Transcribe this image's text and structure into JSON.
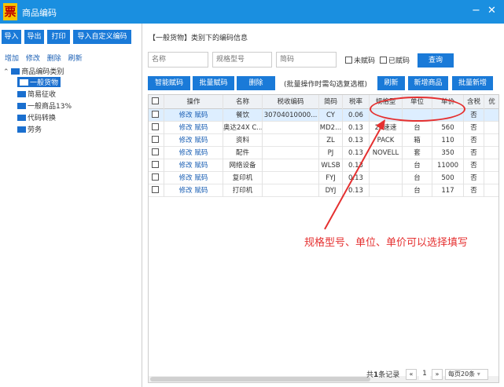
{
  "window": {
    "title": "商品编码",
    "logo_char": "票",
    "minimize": "−",
    "close": "✕"
  },
  "toolbar": {
    "import": "导入",
    "export": "导出",
    "print": "打印",
    "import_custom": "导入自定义编码"
  },
  "links": {
    "add": "增加",
    "edit": "修改",
    "delete": "删除",
    "refresh": "刷新"
  },
  "tree": {
    "root": "商品编码类别",
    "children": [
      "一般货物",
      "简易征收",
      "一般商品13%",
      "代码转换",
      "劳务"
    ]
  },
  "panel": {
    "title": "【一般货物】类别下的编码信息",
    "name_placeholder": "名称",
    "spec_placeholder": "规格型号",
    "short_placeholder": "简码",
    "unassigned": "未赋码",
    "assigned": "已赋码",
    "query": "查询"
  },
  "actions": {
    "smart_assign": "智能赋码",
    "batch_assign": "批量赋码",
    "delete": "删除",
    "hint": "(批量操作时需勾选复选框)",
    "refresh": "刷新",
    "add_goods": "新增商品",
    "batch_add": "批量新增"
  },
  "table": {
    "columns": [
      "操作",
      "名称",
      "税收编码",
      "简码",
      "税率",
      "规格型",
      "单位",
      "单价",
      "含税",
      "优"
    ],
    "op_edit": "修改",
    "op_assign": "赋码",
    "rows": [
      {
        "name": "餐饮",
        "tax_code": "30704010000...",
        "short": "CY",
        "rate": "0.06",
        "spec": "",
        "unit": "",
        "price": "",
        "tax_incl": "否"
      },
      {
        "name": "奥达24X C...",
        "tax_code": "",
        "short": "MD2...",
        "rate": "0.13",
        "spec": "24速速",
        "unit": "台",
        "price": "560",
        "tax_incl": "否"
      },
      {
        "name": "资料",
        "tax_code": "",
        "short": "ZL",
        "rate": "0.13",
        "spec": "PACK",
        "unit": "箱",
        "price": "110",
        "tax_incl": "否"
      },
      {
        "name": "配件",
        "tax_code": "",
        "short": "PJ",
        "rate": "0.13",
        "spec": "NOVELL",
        "unit": "套",
        "price": "350",
        "tax_incl": "否"
      },
      {
        "name": "网络设备",
        "tax_code": "",
        "short": "WLSB",
        "rate": "0.13",
        "spec": "",
        "unit": "台",
        "price": "11000",
        "tax_incl": "否"
      },
      {
        "name": "复印机",
        "tax_code": "",
        "short": "FYJ",
        "rate": "0.13",
        "spec": "",
        "unit": "台",
        "price": "500",
        "tax_incl": "否"
      },
      {
        "name": "打印机",
        "tax_code": "",
        "short": "DYJ",
        "rate": "0.13",
        "spec": "",
        "unit": "台",
        "price": "117",
        "tax_incl": "否"
      }
    ]
  },
  "pager": {
    "total_prefix": "共",
    "total_count": "1",
    "total_suffix": "条记录",
    "prev": "«",
    "page": "1",
    "next": "»",
    "page_size": "每页20条"
  },
  "annotation": {
    "text": "规格型号、单位、单价可以选择填写",
    "color": "#e53030"
  },
  "colors": {
    "accent": "#1a8fe0",
    "button": "#1a7ad8",
    "link": "#1a5fb4"
  }
}
